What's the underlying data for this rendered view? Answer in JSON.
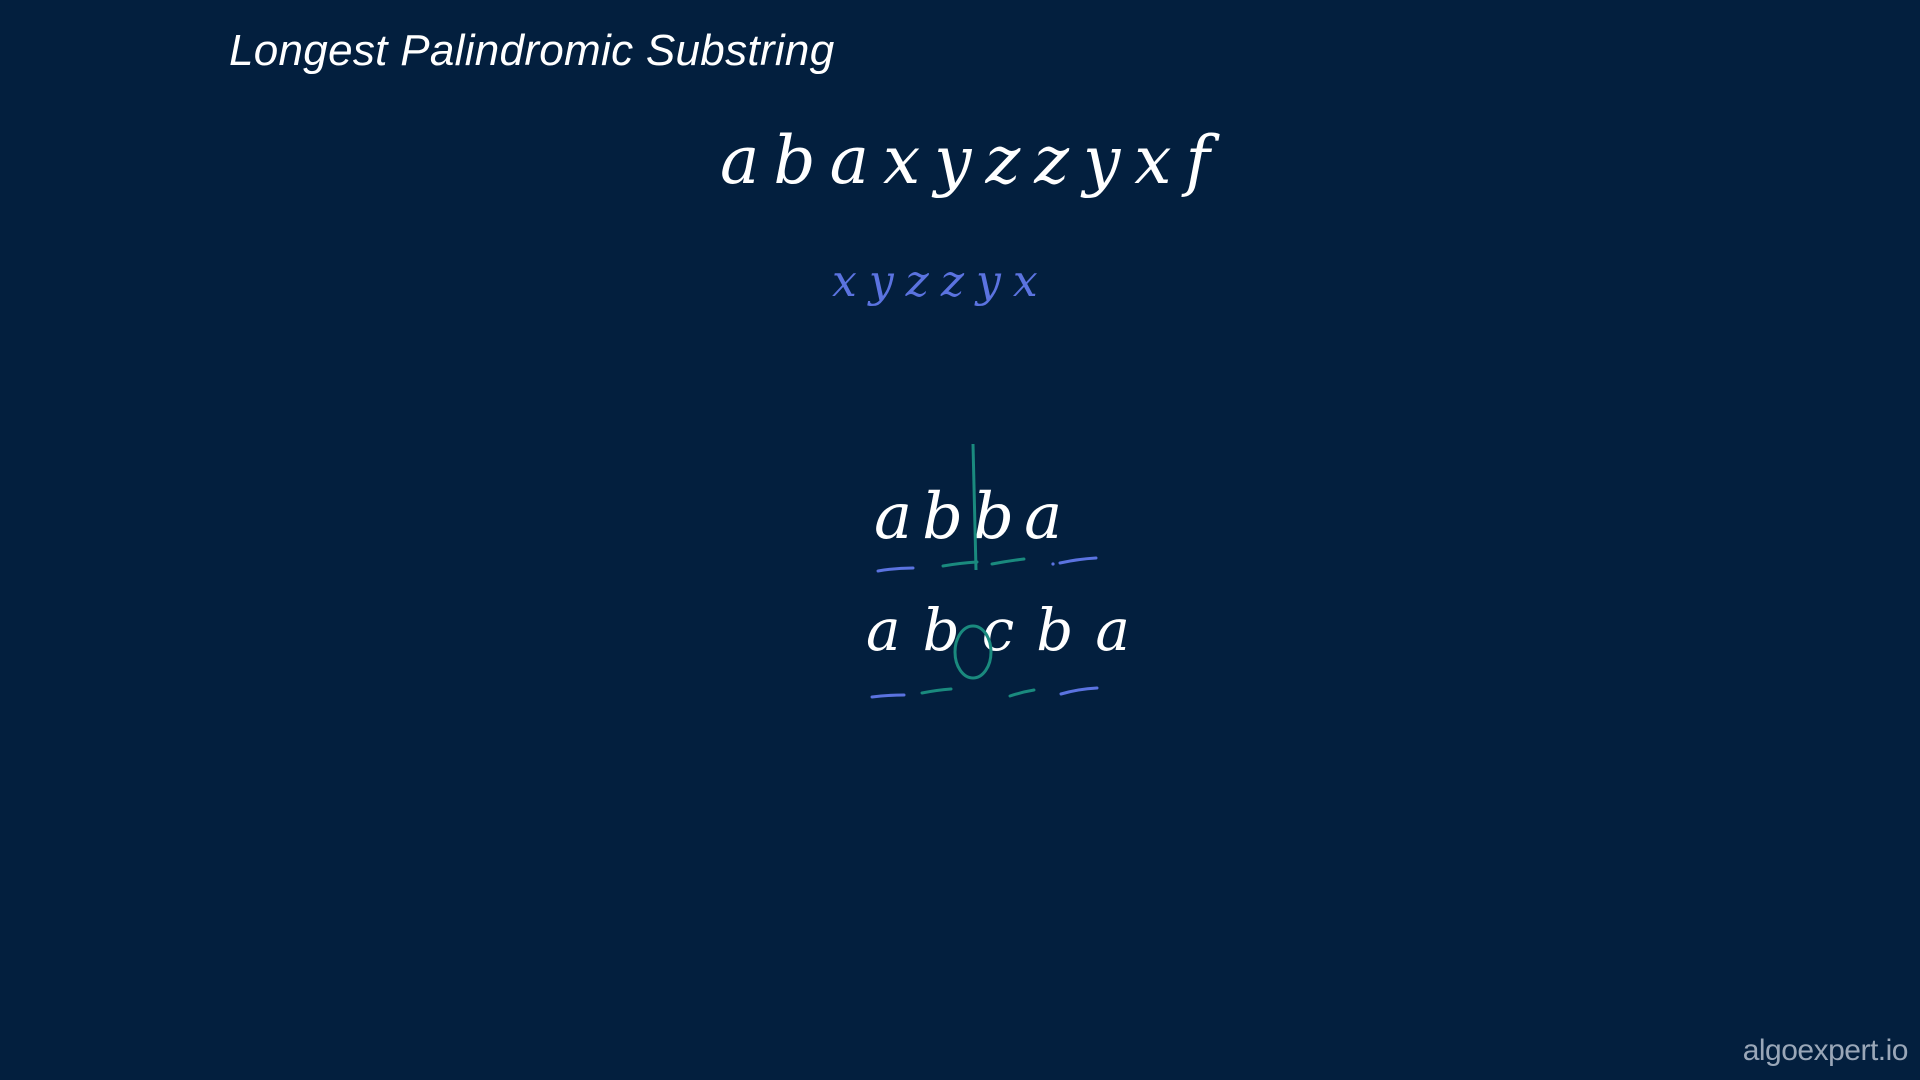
{
  "title": "Longest Palindromic Substring",
  "input_string": "abaxyzzyxf",
  "answer_string": "xyzzyx",
  "examples": {
    "even": "abba",
    "odd": "abcba"
  },
  "watermark": "algoexpert.io",
  "colors": {
    "background": "#031f3e",
    "text": "#ffffff",
    "answer": "#5b73e0",
    "center_marker": "#1a8a7e",
    "underline_outer": "#5b73e0"
  }
}
